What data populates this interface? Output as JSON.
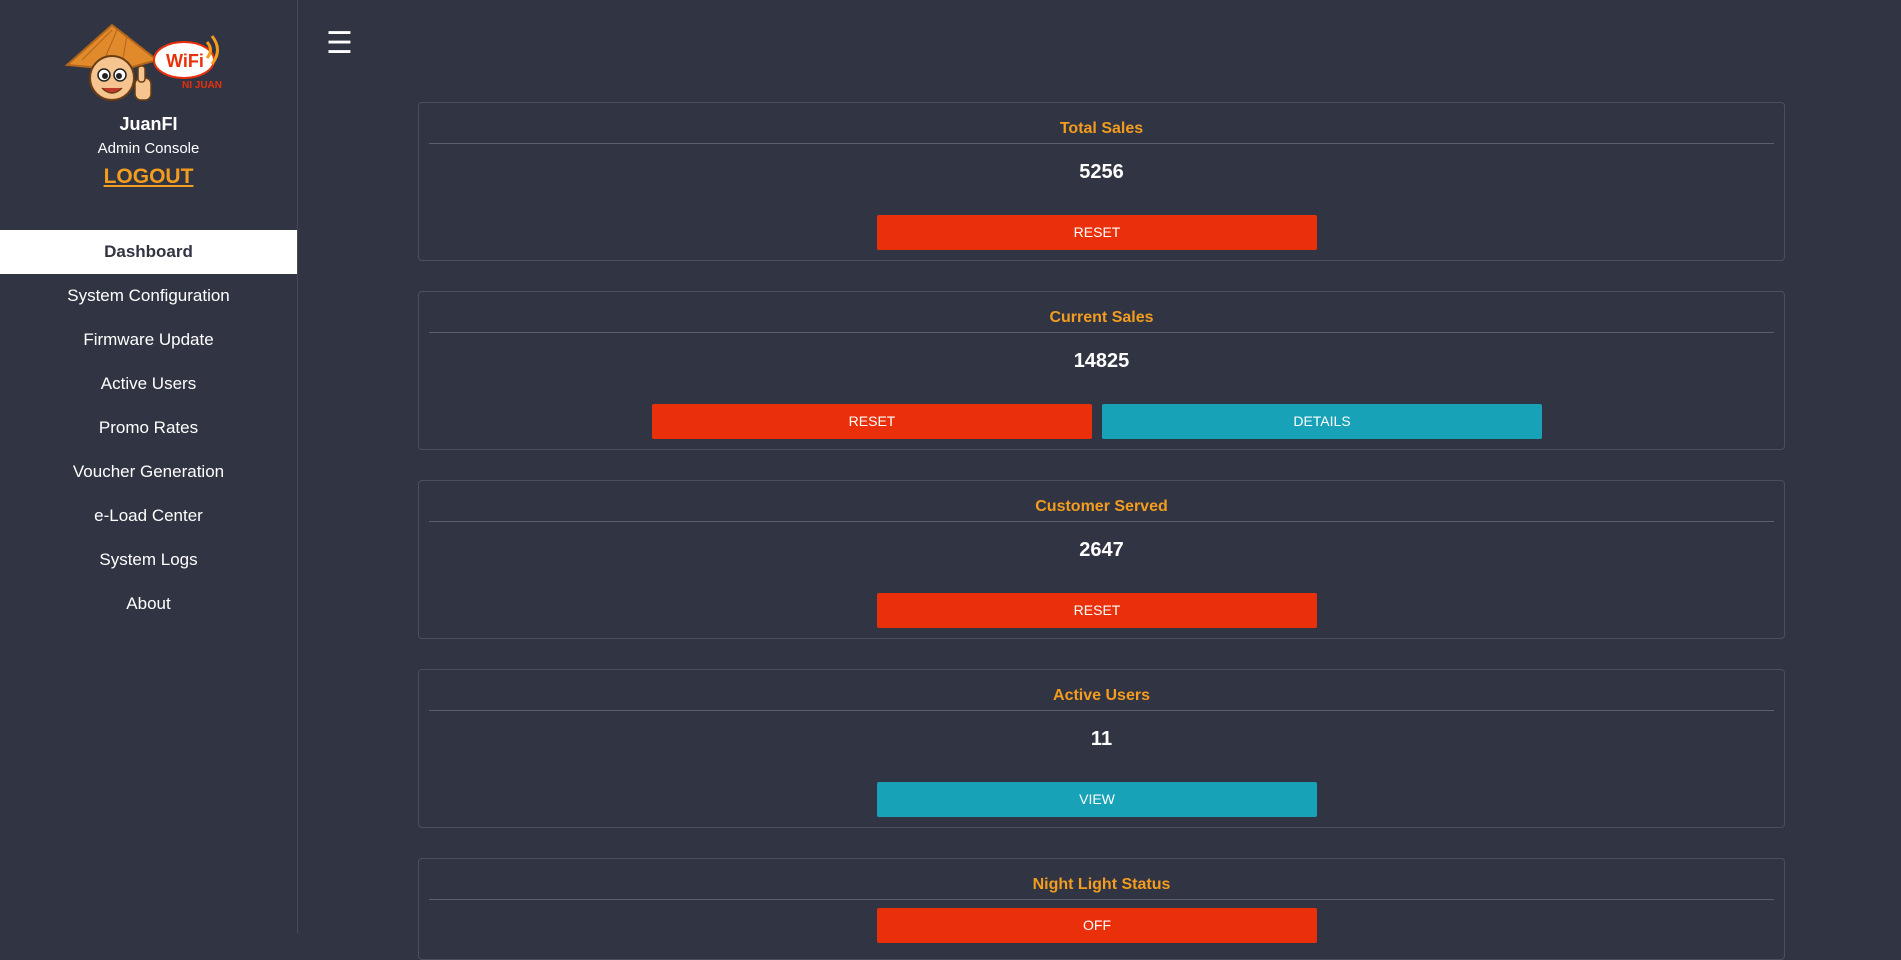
{
  "sidebar": {
    "logo_text": "WiFi",
    "logo_subtext": "NI JUAN",
    "brand_name": "JuanFI",
    "brand_sub": "Admin Console",
    "logout_label": "LOGOUT",
    "items": [
      {
        "label": "Dashboard",
        "active": true
      },
      {
        "label": "System Configuration"
      },
      {
        "label": "Firmware Update"
      },
      {
        "label": "Active Users"
      },
      {
        "label": "Promo Rates"
      },
      {
        "label": "Voucher Generation"
      },
      {
        "label": "e-Load Center"
      },
      {
        "label": "System Logs"
      },
      {
        "label": "About"
      }
    ]
  },
  "header": {
    "menu_icon": "hamburger-icon",
    "menu_glyph": "☰"
  },
  "cards": {
    "total_sales": {
      "title": "Total Sales",
      "value": "5256",
      "reset_label": "RESET"
    },
    "current_sales": {
      "title": "Current Sales",
      "value": "14825",
      "reset_label": "RESET",
      "details_label": "DETAILS"
    },
    "customer_served": {
      "title": "Customer Served",
      "value": "2647",
      "reset_label": "RESET"
    },
    "active_users": {
      "title": "Active Users",
      "value": "11",
      "view_label": "VIEW"
    },
    "night_light": {
      "title": "Night Light Status",
      "toggle_label": "OFF"
    }
  },
  "colors": {
    "background": "#313543",
    "accent": "#f39c1e",
    "danger": "#e9300b",
    "info": "#17a2b8"
  }
}
